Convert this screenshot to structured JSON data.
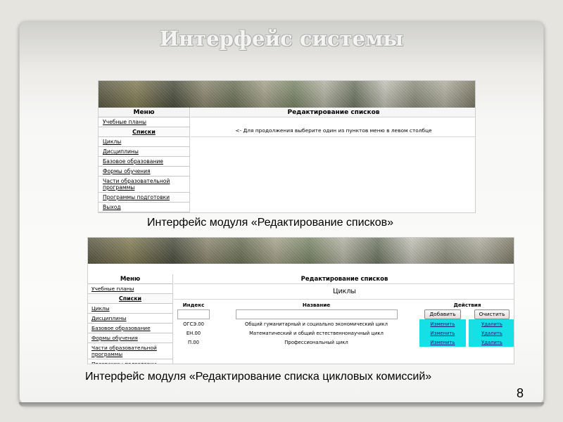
{
  "slide": {
    "title": "Интерфейс системы",
    "caption1": "Интерфейс модуля «Редактирование списков»",
    "caption2": "Интерфейс модуля «Редактирование списка цикловых комиссий»",
    "page_number": "8"
  },
  "shot1": {
    "menu": {
      "title": "Меню",
      "items": [
        {
          "label": "Учебные планы",
          "section": false
        },
        {
          "label": "Списки",
          "section": true
        },
        {
          "label": "Циклы",
          "section": false
        },
        {
          "label": "Дисциплины",
          "section": false
        },
        {
          "label": "Базовое образование",
          "section": false
        },
        {
          "label": "Формы обучения",
          "section": false
        },
        {
          "label": "Части образовательной программы",
          "section": false
        },
        {
          "label": "Программы подготовки",
          "section": false
        },
        {
          "label": "Выход",
          "section": false
        }
      ]
    },
    "content": {
      "title": "Редактирование списков",
      "hint": "<- Для продолжения выберите один из пунктов меню в левом столбце"
    }
  },
  "shot2": {
    "menu": {
      "title": "Меню",
      "items": [
        {
          "label": "Учебные планы",
          "section": false
        },
        {
          "label": "Списки",
          "section": true
        },
        {
          "label": "Циклы",
          "section": false
        },
        {
          "label": "Дисциплины",
          "section": false
        },
        {
          "label": "Базовое образование",
          "section": false
        },
        {
          "label": "Формы обучения",
          "section": false
        },
        {
          "label": "Части образовательной программы",
          "section": false
        },
        {
          "label": "Программы подготовки",
          "section": false
        }
      ]
    },
    "content": {
      "title": "Редактирование списков",
      "subtitle": "Циклы",
      "columns": {
        "index": "Индекс",
        "name": "Название",
        "actions": "Действия"
      },
      "add_label": "Добавить",
      "clear_label": "Очистить",
      "edit_label": "Изменить",
      "delete_label": "Удалить",
      "rows": [
        {
          "index": "ОГСЭ.00",
          "name": "Общий гуманитарный и социально экономический цикл"
        },
        {
          "index": "ЕН.00",
          "name": "Математический и общий естественнонаучный цикл"
        },
        {
          "index": "П.00",
          "name": "Профессиональный цикл"
        }
      ]
    }
  },
  "colors": {
    "action_cell": "#14e0e6"
  }
}
